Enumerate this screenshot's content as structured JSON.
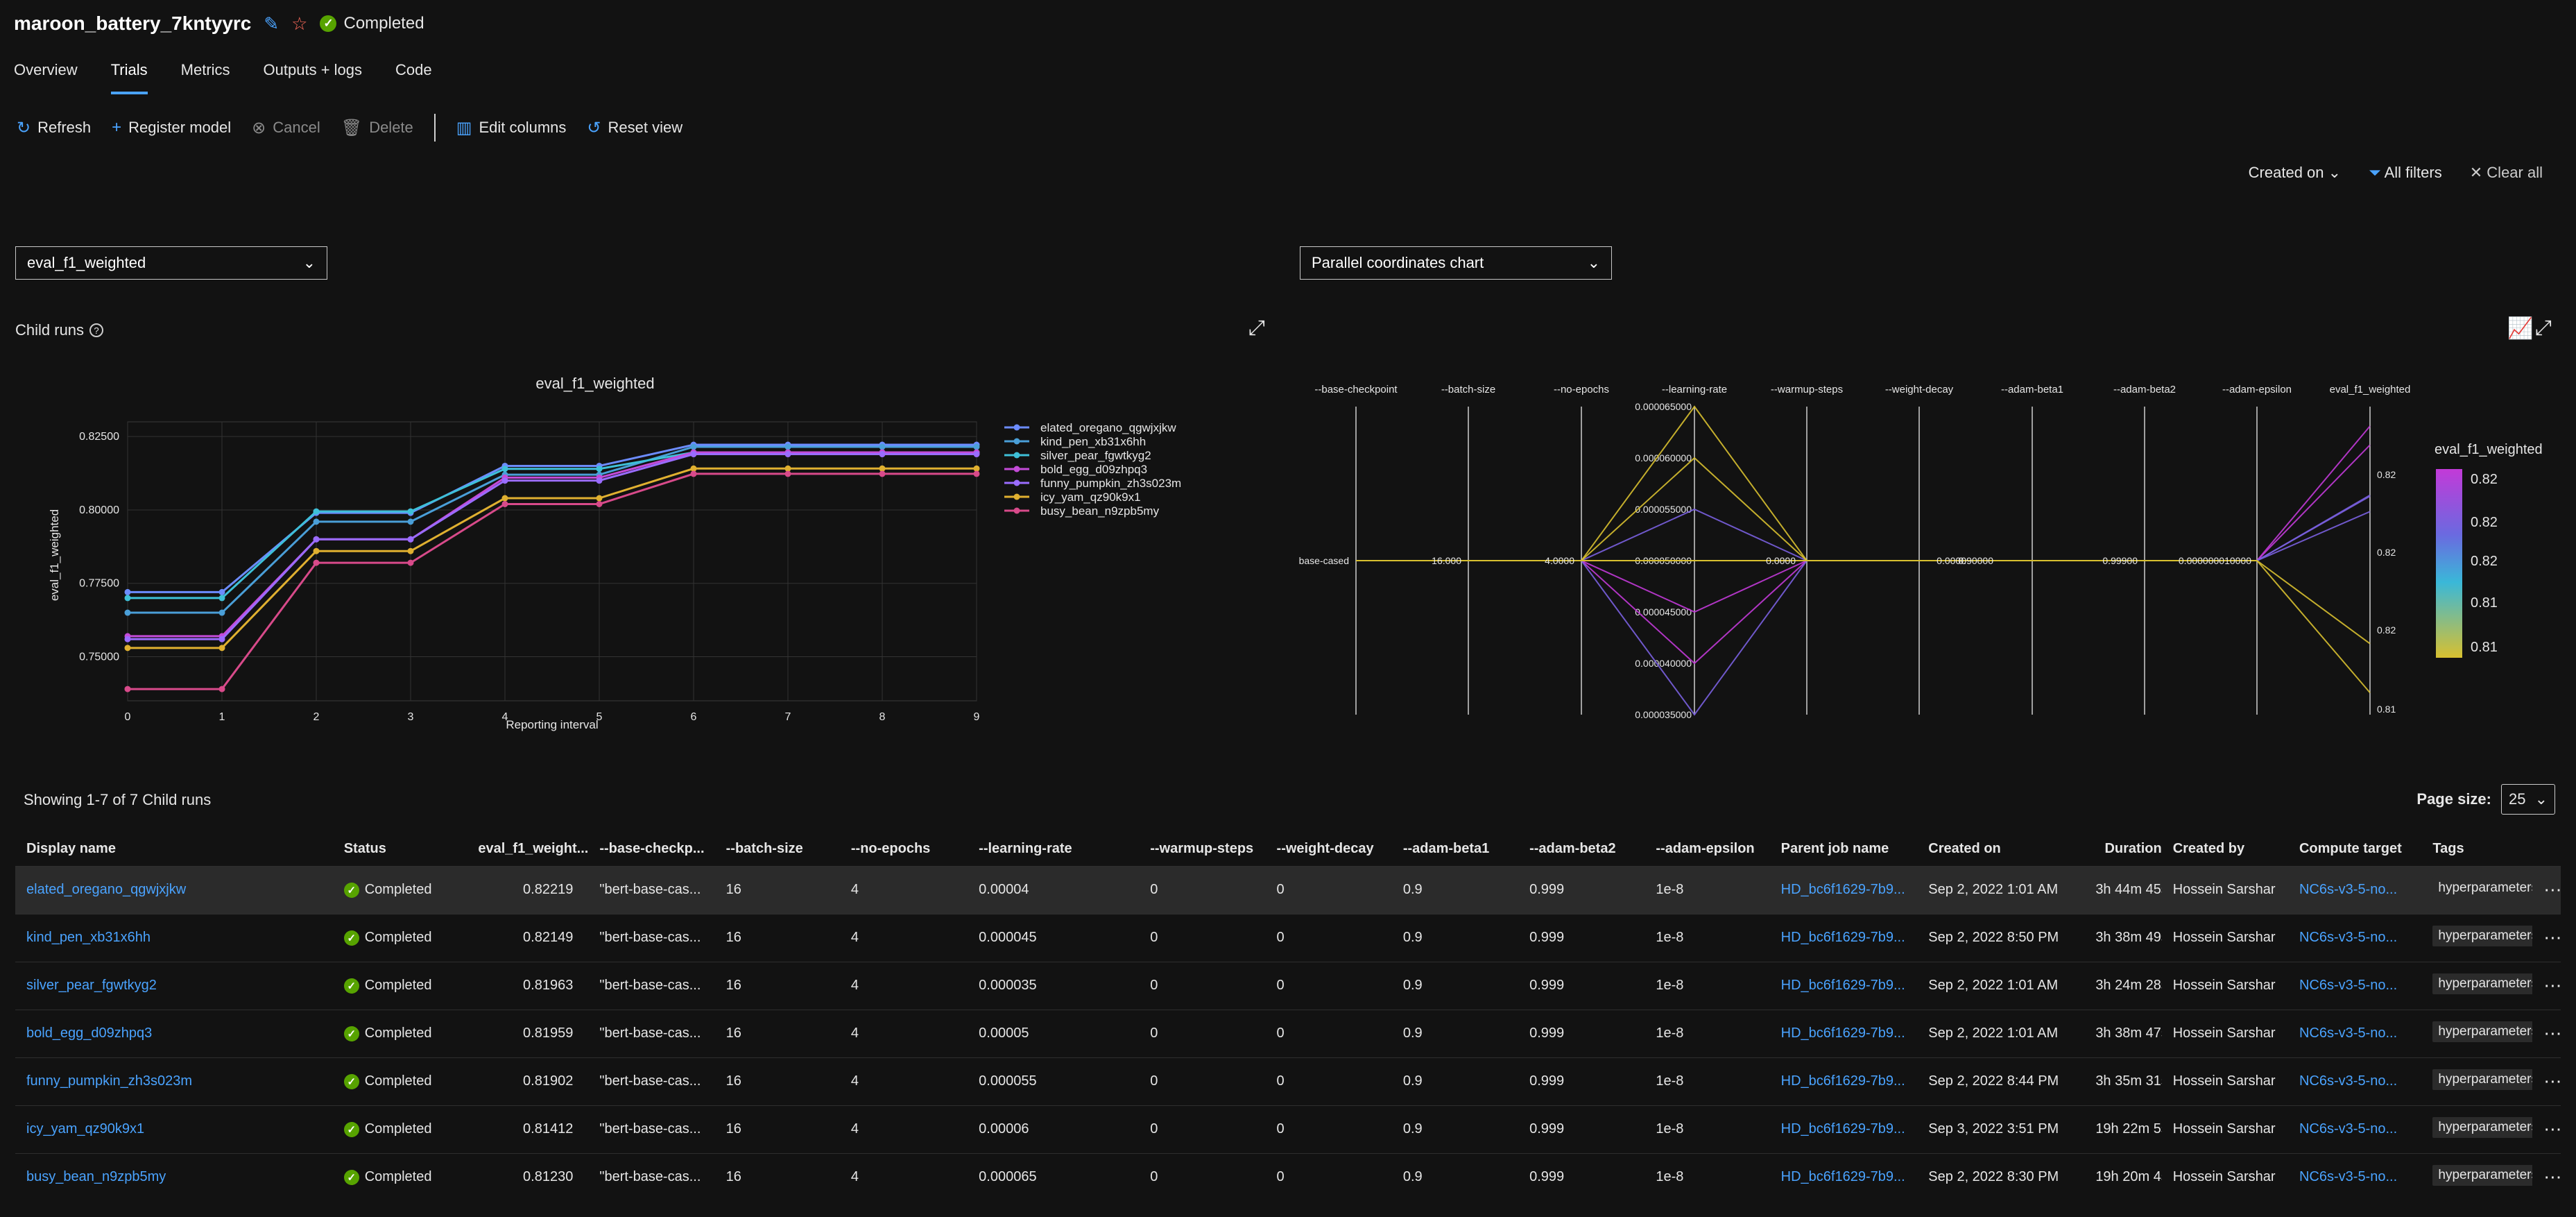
{
  "header": {
    "title": "maroon_battery_7kntyyrc",
    "status": "Completed"
  },
  "tabs": [
    {
      "label": "Overview"
    },
    {
      "label": "Trials"
    },
    {
      "label": "Metrics"
    },
    {
      "label": "Outputs + logs"
    },
    {
      "label": "Code"
    }
  ],
  "toolbar": {
    "refresh": "Refresh",
    "register_model": "Register model",
    "cancel": "Cancel",
    "delete": "Delete",
    "edit_columns": "Edit columns",
    "reset_view": "Reset view"
  },
  "filters": {
    "created_on": "Created on",
    "all_filters": "All filters",
    "clear_all": "Clear all"
  },
  "metric_select": "eval_f1_weighted",
  "chart_select": "Parallel coordinates chart",
  "child_runs_label": "Child runs",
  "line_chart": {
    "title": "eval_f1_weighted",
    "xlabel": "Reporting interval",
    "ylabel": "eval_f1_weighted",
    "yticks": [
      "0.82500",
      "0.80000",
      "0.77500",
      "0.75000"
    ],
    "xticks": [
      "0",
      "1",
      "2",
      "3",
      "4",
      "5",
      "6",
      "7",
      "8",
      "9"
    ]
  },
  "parallel_chart": {
    "axes": [
      "--base-checkpoint",
      "--batch-size",
      "--no-epochs",
      "--learning-rate",
      "--warmup-steps",
      "--weight-decay",
      "--adam-beta1",
      "--adam-beta2",
      "--adam-epsilon",
      "eval_f1_weighted"
    ],
    "lr_ticks": [
      "0.000065000",
      "0.000060000",
      "0.000055000",
      "0.000050000",
      "0.000045000",
      "0.000040000",
      "0.000035000"
    ],
    "mid_values": [
      "base-cased",
      "16.000",
      "4.0000",
      "0.0000",
      "0.0000",
      "0.90000",
      "0.99900",
      "0.000000010000"
    ],
    "f1_ticks": [
      "0.82",
      "0.82",
      "0.82",
      "0.81"
    ],
    "colorbar": {
      "title": "eval_f1_weighted",
      "ticks": [
        "0.82",
        "0.82",
        "0.82",
        "0.81",
        "0.81"
      ]
    }
  },
  "chart_data": {
    "type": "line",
    "title": "eval_f1_weighted",
    "xlabel": "Reporting interval",
    "ylabel": "eval_f1_weighted",
    "x": [
      0,
      1,
      2,
      3,
      4,
      5,
      6,
      7,
      8,
      9
    ],
    "ylim": [
      0.735,
      0.83
    ],
    "grid": true,
    "legend": "right",
    "series": [
      {
        "name": "elated_oregano_qgwjxjkw",
        "color": "#6c8cff",
        "values": [
          0.772,
          0.772,
          0.799,
          0.799,
          0.815,
          0.815,
          0.8222,
          0.8222,
          0.8222,
          0.8222
        ]
      },
      {
        "name": "kind_pen_xb31x6hh",
        "color": "#4a9fd8",
        "values": [
          0.765,
          0.765,
          0.796,
          0.796,
          0.812,
          0.812,
          0.8215,
          0.8215,
          0.8215,
          0.8215
        ]
      },
      {
        "name": "silver_pear_fgwtkyg2",
        "color": "#3ec0d8",
        "values": [
          0.77,
          0.77,
          0.7995,
          0.7995,
          0.814,
          0.814,
          0.8196,
          0.8196,
          0.8196,
          0.8196
        ]
      },
      {
        "name": "bold_egg_d09zhpq3",
        "color": "#c44bd8",
        "values": [
          0.757,
          0.757,
          0.79,
          0.79,
          0.811,
          0.811,
          0.8196,
          0.8196,
          0.8196,
          0.8196
        ]
      },
      {
        "name": "funny_pumpkin_zh3s023m",
        "color": "#9a6cff",
        "values": [
          0.756,
          0.756,
          0.79,
          0.79,
          0.81,
          0.81,
          0.819,
          0.819,
          0.819,
          0.819
        ]
      },
      {
        "name": "icy_yam_qz90k9x1",
        "color": "#e0b030",
        "values": [
          0.753,
          0.753,
          0.786,
          0.786,
          0.804,
          0.804,
          0.8141,
          0.8141,
          0.8141,
          0.8141
        ]
      },
      {
        "name": "busy_bean_n9zpb5my",
        "color": "#d84a8a",
        "values": [
          0.739,
          0.739,
          0.782,
          0.782,
          0.802,
          0.802,
          0.8123,
          0.8123,
          0.8123,
          0.8123
        ]
      }
    ]
  },
  "table": {
    "showing": "Showing 1-7 of 7 Child runs",
    "page_size_label": "Page size:",
    "page_size": "25",
    "columns": [
      "Display name",
      "Status",
      "eval_f1_weight...",
      "--base-checkp...",
      "--batch-size",
      "--no-epochs",
      "--learning-rate",
      "--warmup-steps",
      "--weight-decay",
      "--adam-beta1",
      "--adam-beta2",
      "--adam-epsilon",
      "Parent job name",
      "Created on",
      "Duration",
      "Created by",
      "Compute target",
      "Tags"
    ],
    "rows": [
      {
        "name": "elated_oregano_qgwjxjkw",
        "status": "Completed",
        "f1": "0.82219",
        "base": "\"bert-base-cas...",
        "batch": "16",
        "epochs": "4",
        "lr": "0.00004",
        "warmup": "0",
        "wd": "0",
        "b1": "0.9",
        "b2": "0.999",
        "eps": "1e-8",
        "parent": "HD_bc6f1629-7b9...",
        "created": "Sep 2, 2022 1:01 AM",
        "duration": "3h 44m 45s",
        "by": "Hossein Sarshar",
        "compute": "NC6s-v3-5-no...",
        "tags": "hyperparameters"
      },
      {
        "name": "kind_pen_xb31x6hh",
        "status": "Completed",
        "f1": "0.82149",
        "base": "\"bert-base-cas...",
        "batch": "16",
        "epochs": "4",
        "lr": "0.000045",
        "warmup": "0",
        "wd": "0",
        "b1": "0.9",
        "b2": "0.999",
        "eps": "1e-8",
        "parent": "HD_bc6f1629-7b9...",
        "created": "Sep 2, 2022 8:50 PM",
        "duration": "3h 38m 49s",
        "by": "Hossein Sarshar",
        "compute": "NC6s-v3-5-no...",
        "tags": "hyperparameters"
      },
      {
        "name": "silver_pear_fgwtkyg2",
        "status": "Completed",
        "f1": "0.81963",
        "base": "\"bert-base-cas...",
        "batch": "16",
        "epochs": "4",
        "lr": "0.000035",
        "warmup": "0",
        "wd": "0",
        "b1": "0.9",
        "b2": "0.999",
        "eps": "1e-8",
        "parent": "HD_bc6f1629-7b9...",
        "created": "Sep 2, 2022 1:01 AM",
        "duration": "3h 24m 28s",
        "by": "Hossein Sarshar",
        "compute": "NC6s-v3-5-no...",
        "tags": "hyperparameters"
      },
      {
        "name": "bold_egg_d09zhpq3",
        "status": "Completed",
        "f1": "0.81959",
        "base": "\"bert-base-cas...",
        "batch": "16",
        "epochs": "4",
        "lr": "0.00005",
        "warmup": "0",
        "wd": "0",
        "b1": "0.9",
        "b2": "0.999",
        "eps": "1e-8",
        "parent": "HD_bc6f1629-7b9...",
        "created": "Sep 2, 2022 1:01 AM",
        "duration": "3h 38m 47s",
        "by": "Hossein Sarshar",
        "compute": "NC6s-v3-5-no...",
        "tags": "hyperparameters"
      },
      {
        "name": "funny_pumpkin_zh3s023m",
        "status": "Completed",
        "f1": "0.81902",
        "base": "\"bert-base-cas...",
        "batch": "16",
        "epochs": "4",
        "lr": "0.000055",
        "warmup": "0",
        "wd": "0",
        "b1": "0.9",
        "b2": "0.999",
        "eps": "1e-8",
        "parent": "HD_bc6f1629-7b9...",
        "created": "Sep 2, 2022 8:44 PM",
        "duration": "3h 35m 31s",
        "by": "Hossein Sarshar",
        "compute": "NC6s-v3-5-no...",
        "tags": "hyperparameters"
      },
      {
        "name": "icy_yam_qz90k9x1",
        "status": "Completed",
        "f1": "0.81412",
        "base": "\"bert-base-cas...",
        "batch": "16",
        "epochs": "4",
        "lr": "0.00006",
        "warmup": "0",
        "wd": "0",
        "b1": "0.9",
        "b2": "0.999",
        "eps": "1e-8",
        "parent": "HD_bc6f1629-7b9...",
        "created": "Sep 3, 2022 3:51 PM",
        "duration": "19h 22m 5s",
        "by": "Hossein Sarshar",
        "compute": "NC6s-v3-5-no...",
        "tags": "hyperparameters"
      },
      {
        "name": "busy_bean_n9zpb5my",
        "status": "Completed",
        "f1": "0.81230",
        "base": "\"bert-base-cas...",
        "batch": "16",
        "epochs": "4",
        "lr": "0.000065",
        "warmup": "0",
        "wd": "0",
        "b1": "0.9",
        "b2": "0.999",
        "eps": "1e-8",
        "parent": "HD_bc6f1629-7b9...",
        "created": "Sep 2, 2022 8:30 PM",
        "duration": "19h 20m 4s",
        "by": "Hossein Sarshar",
        "compute": "NC6s-v3-5-no...",
        "tags": "hyperparameters"
      }
    ]
  }
}
